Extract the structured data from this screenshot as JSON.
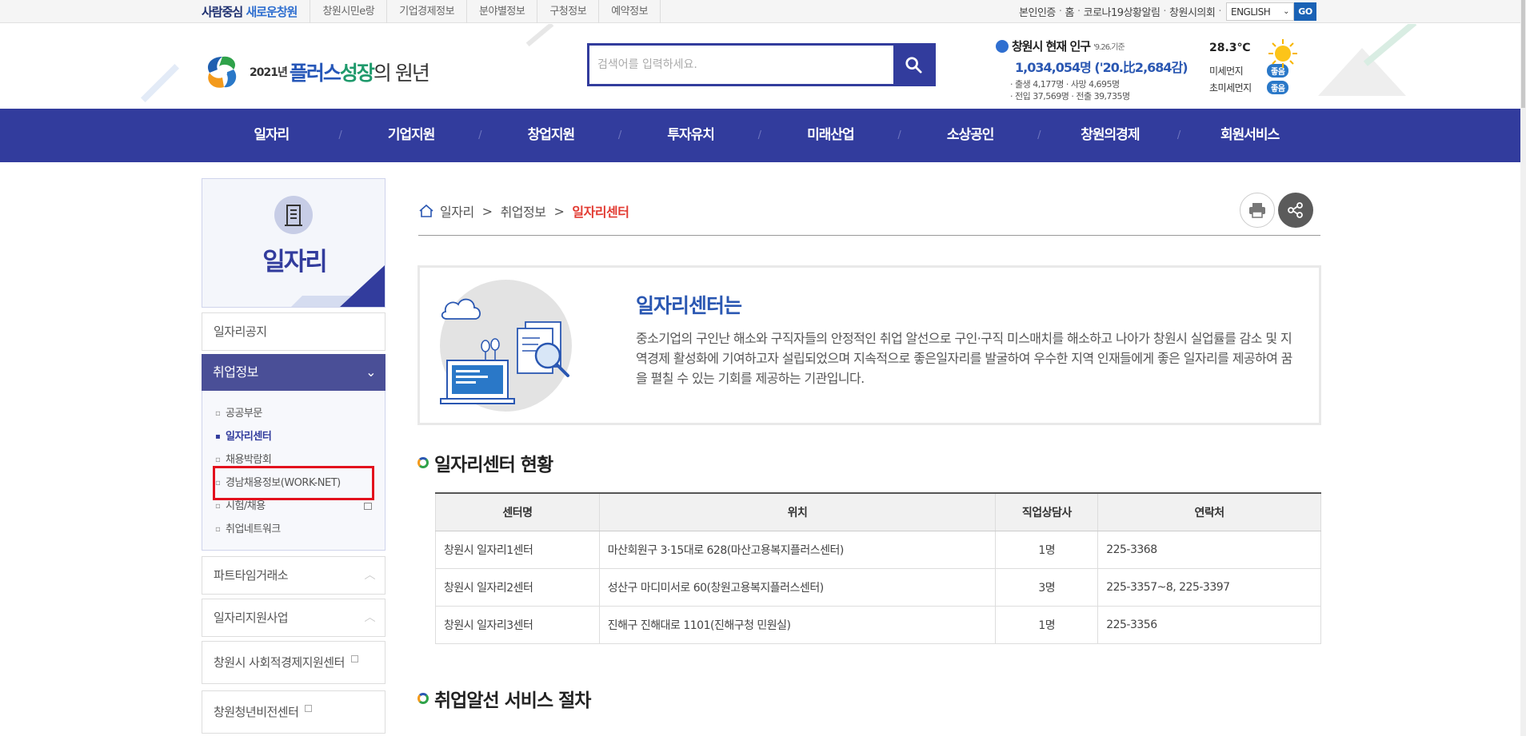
{
  "topbar": {
    "slogan_a": "사람중심",
    "slogan_b": "새로운창원",
    "links": [
      "창원시민e랑",
      "기업경제정보",
      "분야별정보",
      "구청정보",
      "예약정보"
    ],
    "right": [
      "본인인증",
      "홈",
      "코로나19상황알림",
      "창원시의회"
    ],
    "lang_value": "ENGLISH",
    "go_label": "GO"
  },
  "header": {
    "logo_year": "2021년",
    "logo_plus": "플러스",
    "logo_growth": "성장",
    "logo_tail": "의 원년",
    "search_placeholder": "검색어를 입력하세요.",
    "population": {
      "title": "창원시 현재 인구",
      "basis": "'9.26.기준",
      "total": "1,034,054명 ('20.比2,684감)",
      "line1": "· 출생 4,177명    · 사망 4,695명",
      "line2": "· 전입 37,569명  · 전출 39,735명"
    },
    "weather": {
      "temp": "28.3℃",
      "dust_label": "미세먼지",
      "dust_value": "좋음",
      "fine_dust_label": "초미세먼지",
      "fine_dust_value": "좋음"
    }
  },
  "gnb": [
    "일자리",
    "기업지원",
    "창업지원",
    "투자유치",
    "미래산업",
    "소상공인",
    "창원의경제",
    "회원서비스"
  ],
  "lnb": {
    "title": "일자리",
    "item_notice": "일자리공지",
    "active_group": "취업정보",
    "sub_items": [
      "공공부문",
      "일자리센터",
      "채용박람회",
      "경남채용정보(WORK-NET)",
      "시험/채용",
      "취업네트워크"
    ],
    "item_parttime": "파트타임거래소",
    "item_support": "일자리지원사업",
    "item_social": "창원시 사회적경제지원센터",
    "item_youth": "창원청년비전센터"
  },
  "breadcrumb": {
    "level1": "일자리",
    "level2": "취업정보",
    "current": "일자리센터",
    "sep": ">"
  },
  "intro": {
    "title": "일자리센터는",
    "body": "중소기업의 구인난 해소와 구직자들의 안정적인 취업 알선으로 구인·구직 미스매치를 해소하고 나아가 창원시 실업률를 감소 및 지역경제 활성화에 기여하고자 설립되었으며 지속적으로 좋은일자리를 발굴하여 우수한 지역 인재들에게 좋은 일자리를 제공하여 꿈을 펼칠 수 있는 기회를 제공하는 기관입니다."
  },
  "section1_title": "일자리센터 현황",
  "section2_title": "취업알선 서비스 절차",
  "table": {
    "headers": [
      "센터명",
      "위치",
      "직업상담사",
      "연락처"
    ],
    "rows": [
      [
        "창원시 일자리1센터",
        "마산회원구 3·15대로 628(마산고용복지플러스센터)",
        "1명",
        "225-3368"
      ],
      [
        "창원시 일자리2센터",
        "성산구 마디미서로 60(창원고용복지플러스센터)",
        "3명",
        "225-3357~8, 225-3397"
      ],
      [
        "창원시 일자리3센터",
        "진해구 진해대로 1101(진해구청 민원실)",
        "1명",
        "225-3356"
      ]
    ]
  },
  "colors": {
    "primary": "#323c9d",
    "accent_red": "#e23a31",
    "highlight": "#e3101d"
  }
}
